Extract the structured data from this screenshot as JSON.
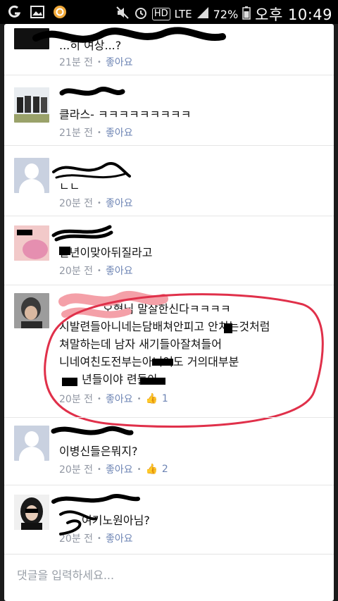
{
  "status_bar": {
    "battery": "72%",
    "time": "오후 10:49",
    "network": "LTE",
    "hd_badge": "HD"
  },
  "comments": [
    {
      "text": "...히 여상...?",
      "time": "21분 전",
      "like_label": "좋아요"
    },
    {
      "text": "클라스- ㅋㅋㅋㅋㅋㅋㅋㅋㅋ",
      "time": "21분 전",
      "like_label": "좋아요"
    },
    {
      "text": "ㄴㄴ",
      "time": "20분 전",
      "like_label": "좋아요"
    },
    {
      "text": "발년이맞아뒤질라고",
      "time": "20분 전",
      "like_label": "좋아요"
    },
    {
      "lines": [
        "오형님 말잘한신다ㅋㅋㅋㅋ",
        "시발련들아니네는담배쳐안피고 안치는것처럼",
        "쳐말하는데 남자  새기들아잘쳐들어",
        "니네여친도전부는아니여도 거의대부분",
        "년들이야  련들아"
      ],
      "time": "20분 전",
      "like_label": "좋아요",
      "likes": "1"
    },
    {
      "text": "이병신들은뭐지?",
      "time": "20분 전",
      "like_label": "좋아요",
      "likes": "2"
    },
    {
      "text": "여기노원아님?",
      "time": "20분 전",
      "like_label": "좋아요"
    }
  ],
  "input": {
    "placeholder": "댓글을 입력하세요..."
  },
  "colors": {
    "link": "#6d84b4",
    "meta": "#9197a3",
    "highlight_circle": "#e0304a",
    "scribble": "#000000"
  }
}
